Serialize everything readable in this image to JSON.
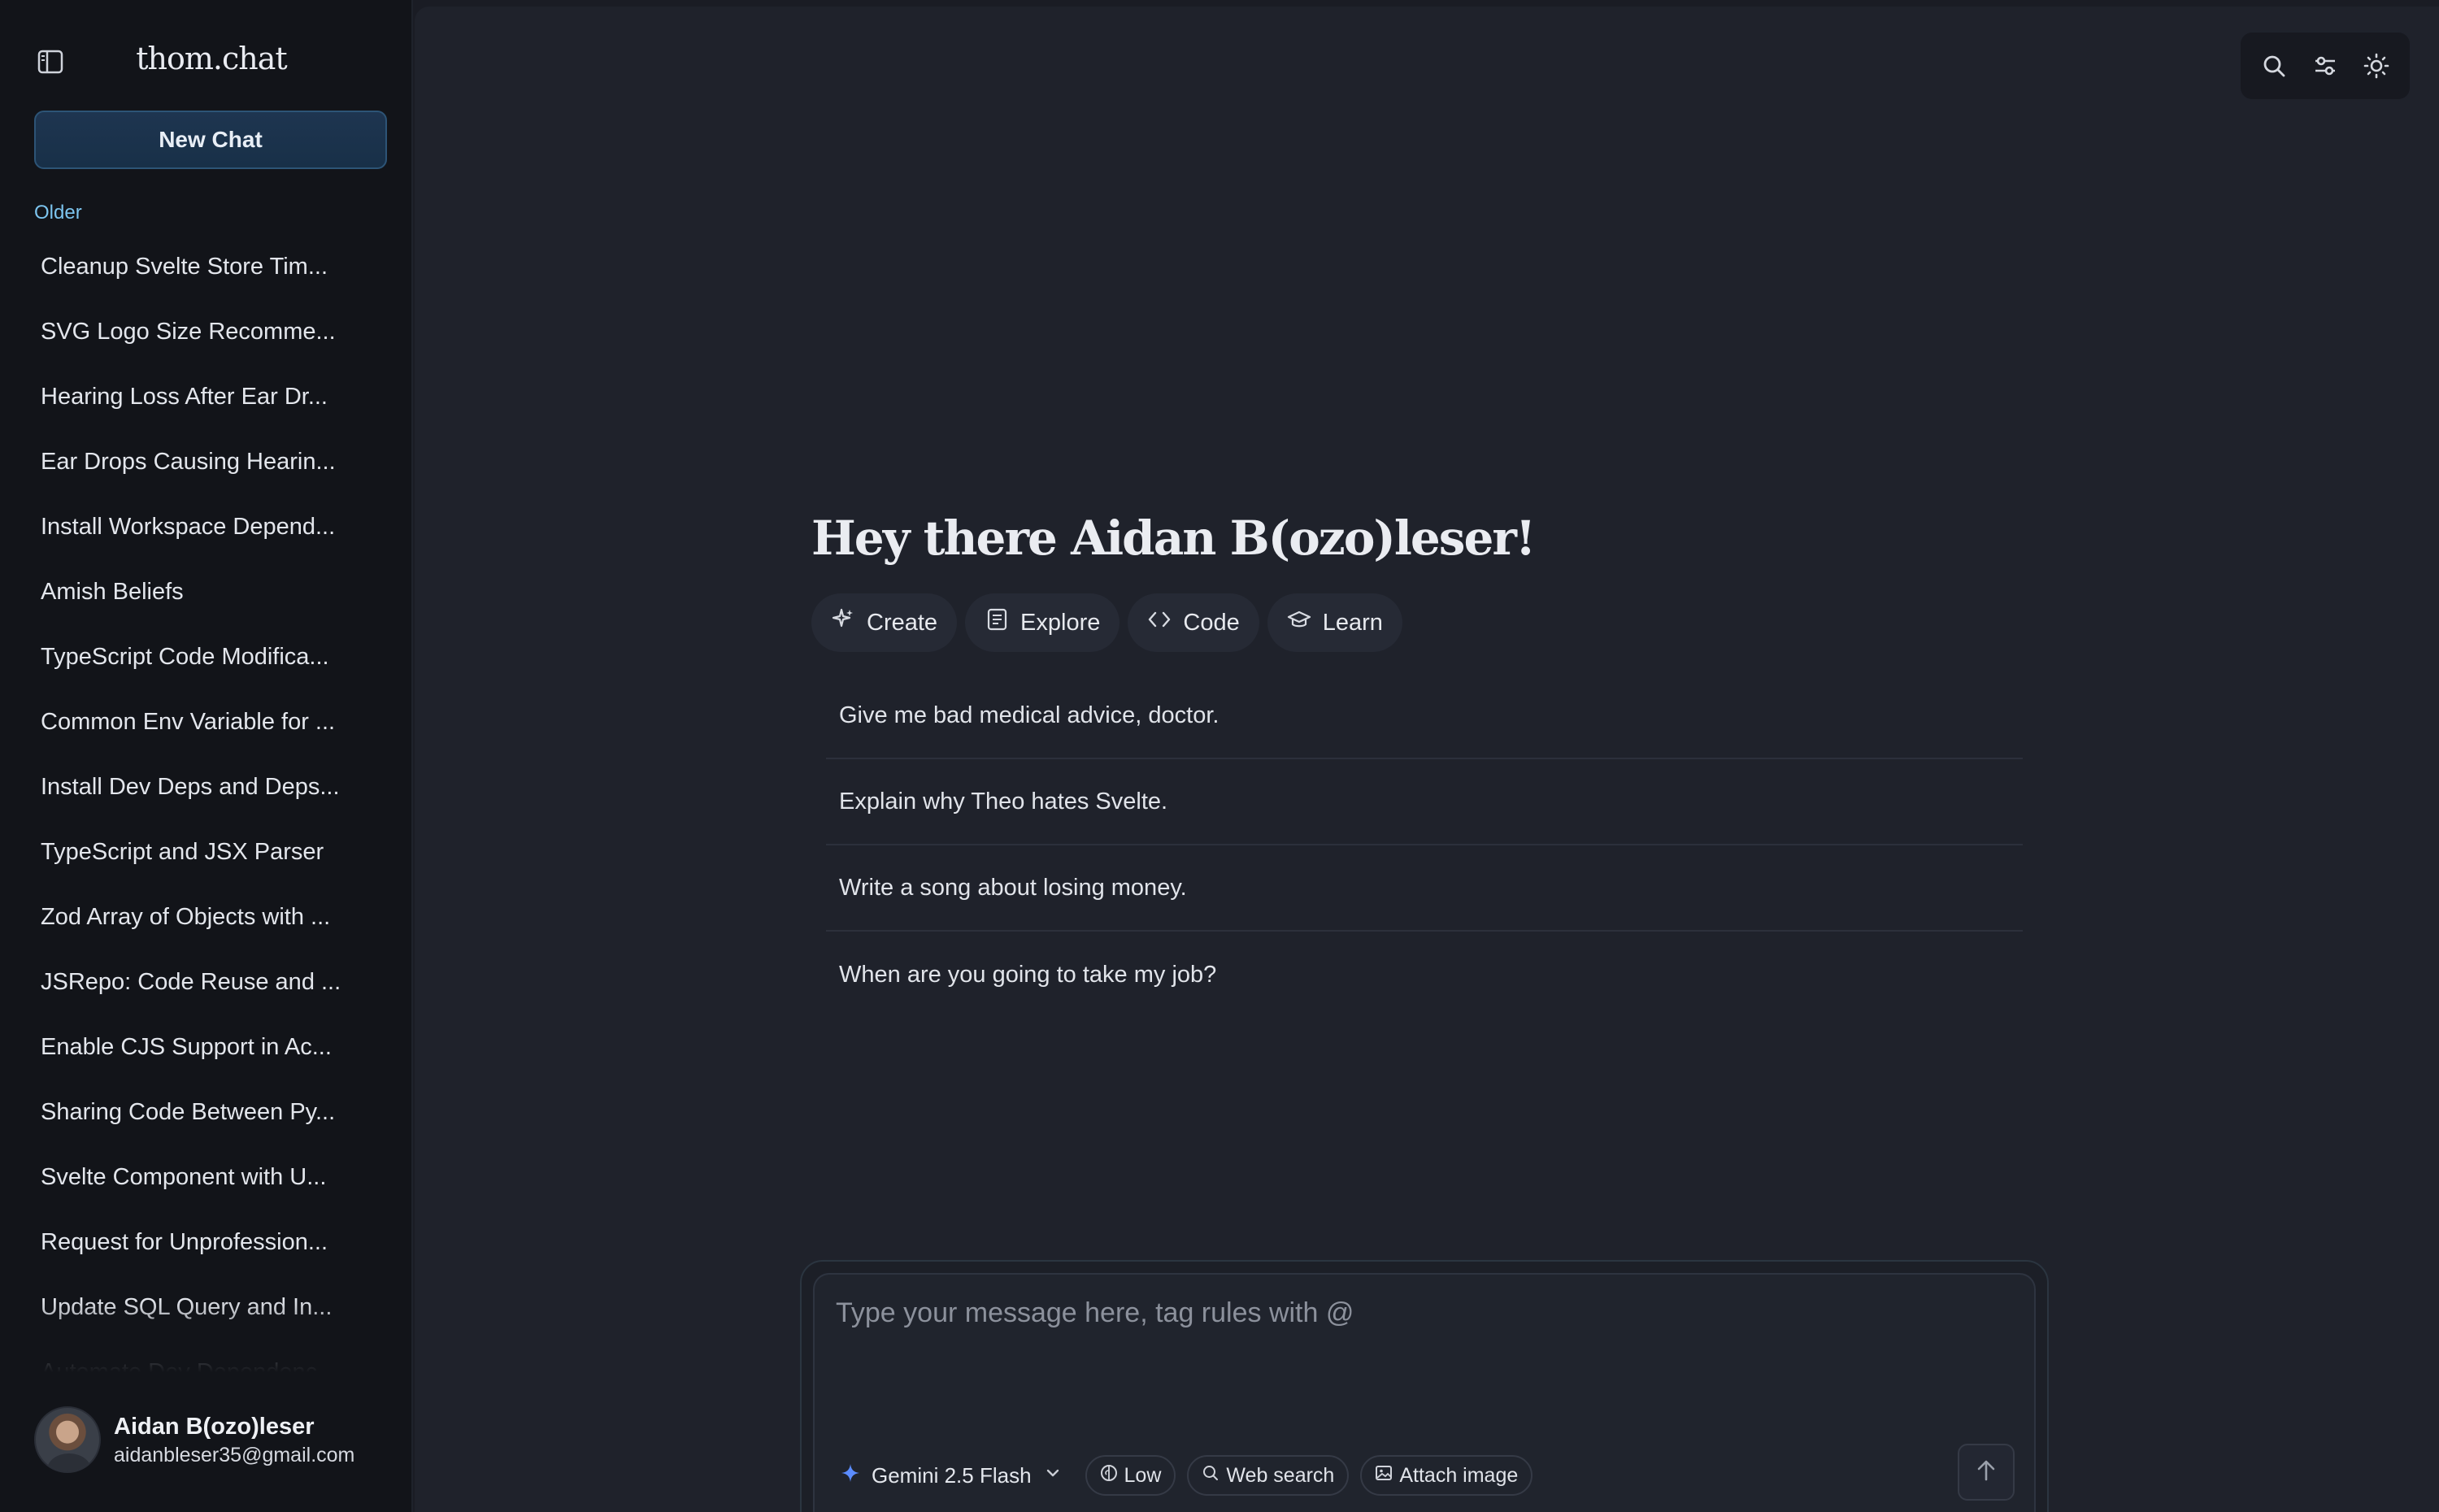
{
  "app": {
    "brand": "thom.chat"
  },
  "sidebar": {
    "new_chat_label": "New Chat",
    "section_label": "Older",
    "chats": [
      "Cleanup Svelte Store Tim...",
      "SVG Logo Size Recomme...",
      "Hearing Loss After Ear Dr...",
      "Ear Drops Causing Hearin...",
      "Install Workspace Depend...",
      "Amish Beliefs",
      "TypeScript Code Modifica...",
      "Common Env Variable for ...",
      "Install Dev Deps and Deps...",
      "TypeScript and JSX Parser",
      "Zod Array of Objects with ...",
      "JSRepo: Code Reuse and ...",
      "Enable CJS Support in Ac...",
      "Sharing Code Between Py...",
      "Svelte Component with U...",
      "Request for Unprofession...",
      "Update SQL Query and In...",
      "Automate Dev Dependenc..."
    ],
    "user": {
      "name": "Aidan B(ozo)leser",
      "email": "aidanbleser35@gmail.com"
    }
  },
  "topbar": {
    "icons": [
      "search-icon",
      "settings-sliders-icon",
      "sun-icon"
    ]
  },
  "main": {
    "greeting": "Hey there Aidan B(ozo)leser!",
    "categories": [
      {
        "label": "Create",
        "icon": "sparkles-icon"
      },
      {
        "label": "Explore",
        "icon": "newspaper-icon"
      },
      {
        "label": "Code",
        "icon": "code-icon"
      },
      {
        "label": "Learn",
        "icon": "graduation-cap-icon"
      }
    ],
    "suggestions": [
      "Give me bad medical advice, doctor.",
      "Explain why Theo hates Svelte.",
      "Write a song about losing money.",
      "When are you going to take my job?"
    ]
  },
  "composer": {
    "placeholder": "Type your message here, tag rules with @",
    "model": "Gemini 2.5 Flash",
    "reasoning": "Low",
    "web_search": "Web search",
    "attach": "Attach image"
  },
  "colors": {
    "accent": "#1e3550",
    "accent_border": "#2d5476",
    "section_label": "#7cc4ee",
    "gemini_star": "#5b8cff"
  }
}
